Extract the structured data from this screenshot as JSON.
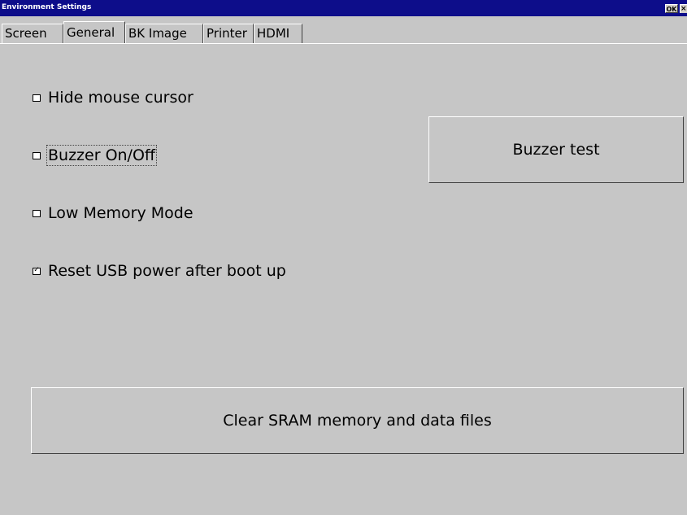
{
  "window": {
    "title": "Environment Settings",
    "ok_label": "OK",
    "close_label": "×"
  },
  "tabs": [
    {
      "label": "Screen",
      "active": false
    },
    {
      "label": "General",
      "active": true
    },
    {
      "label": "BK Image",
      "active": false
    },
    {
      "label": "Printer",
      "active": false
    },
    {
      "label": "HDMI",
      "active": false
    }
  ],
  "options": [
    {
      "label": "Hide mouse cursor",
      "checked": false
    },
    {
      "label": "Buzzer On/Off",
      "checked": false
    },
    {
      "label": "Low Memory Mode",
      "checked": false
    },
    {
      "label": "Reset USB power after boot up",
      "checked": true
    }
  ],
  "buttons": {
    "buzzer_test": "Buzzer test",
    "clear_sram": "Clear SRAM memory and data files"
  },
  "colors": {
    "titlebar": "#0d0d8a",
    "background": "#c6c6c6"
  }
}
